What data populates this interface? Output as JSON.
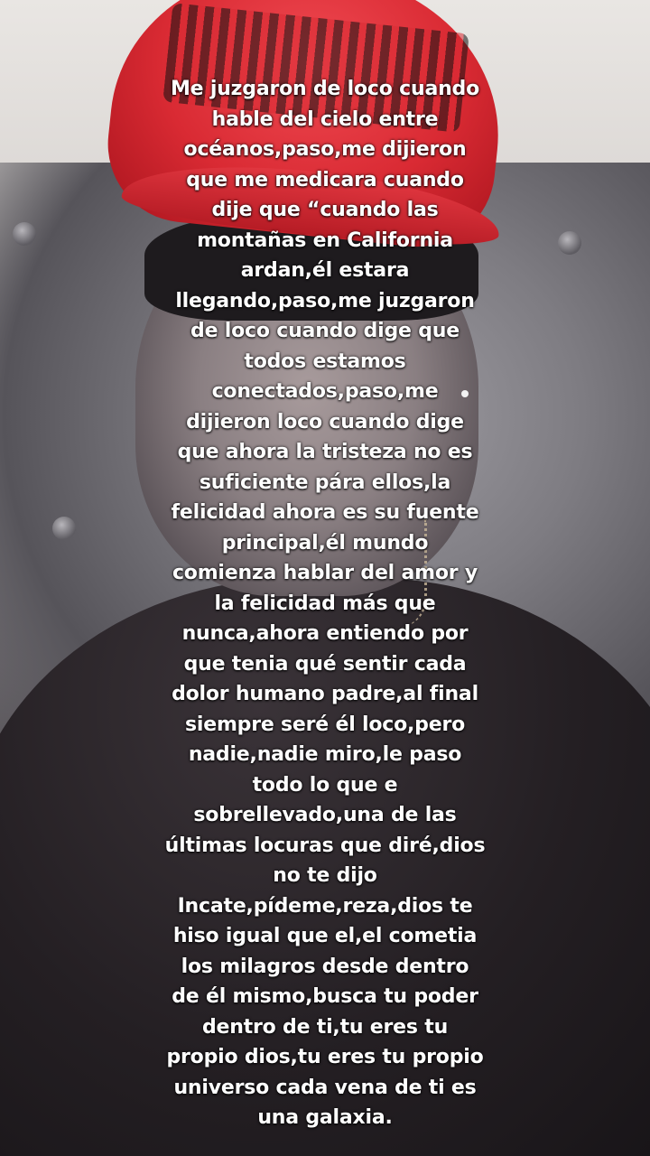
{
  "caption": {
    "text": "Me juzgaron de loco cuando\nhable del cielo entre\nocéanos,paso,me dijieron\nque me medicara cuando\ndije que “cuando las\nmontañas en California\nardan,él estara\nllegando,paso,me juzgaron\nde loco cuando dige que\ntodos estamos\nconectados,paso,me\ndijieron loco cuando dige\nque ahora la tristeza no es\nsuficiente pára ellos,la\nfelicidad ahora es su fuente\nprincipal,él mundo\ncomienza hablar del amor y\nla felicidad más que\nnunca,ahora entiendo por\nque tenia qué sentir cada\ndolor humano padre,al final\nsiempre seré él loco,pero\nnadie,nadie miro,le paso\ntodo lo que e\nsobrellevado,una de las\núltimas locuras que diré,dios\nno te dijo\nIncate,pídeme,reza,dios te\nhiso igual que el,el cometia\nlos milagros desde dentro\nde él mismo,busca tu poder\ndentro de ti,tu eres tu\npropio dios,tu eres tu propio\nuniverso cada vena de ti es\nuna galaxia.",
    "color": "#ffffff"
  },
  "scene": {
    "cap_color": "#d92a33",
    "wall_color": "#e9e6e3",
    "headboard_color": "#7e7c82",
    "shirt_color": "#241f23"
  }
}
